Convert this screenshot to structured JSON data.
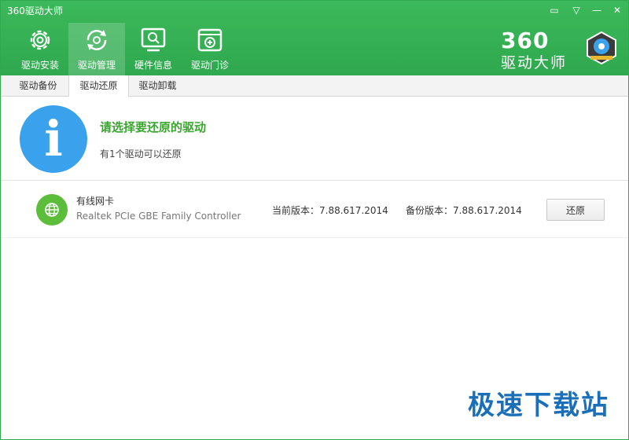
{
  "window": {
    "title": "360驱动大师"
  },
  "window_controls": [
    {
      "icon": "feedback-icon",
      "glyph": "▭"
    },
    {
      "icon": "menu-icon",
      "glyph": "▽"
    },
    {
      "icon": "minimize-icon",
      "glyph": "—"
    },
    {
      "icon": "close-icon",
      "glyph": "✕"
    }
  ],
  "nav": [
    {
      "label": "驱动安装",
      "icon": "gear-icon",
      "active": false
    },
    {
      "label": "驱动管理",
      "icon": "refresh-icon",
      "active": true
    },
    {
      "label": "硬件信息",
      "icon": "monitor-search-icon",
      "active": false
    },
    {
      "label": "驱动门诊",
      "icon": "clinic-icon",
      "active": false
    }
  ],
  "brand": {
    "number": "360",
    "name": "驱动大师"
  },
  "subtabs": [
    {
      "label": "驱动备份",
      "active": false
    },
    {
      "label": "驱动还原",
      "active": true
    },
    {
      "label": "驱动卸载",
      "active": false
    }
  ],
  "info": {
    "icon_glyph": "i",
    "title": "请选择要还原的驱动",
    "subtitle": "有1个驱动可以还原"
  },
  "drivers": [
    {
      "name": "有线网卡",
      "model": "Realtek PCIe GBE Family Controller",
      "current_version": "当前版本：7.88.617.2014",
      "backup_version": "备份版本：7.88.617.2014",
      "action_label": "还原",
      "icon": "network-globe-icon"
    }
  ],
  "watermark": "极速下载站",
  "colors": {
    "header_green": "#2fa84f",
    "title_green": "#3aa52f",
    "info_blue": "#3aa1ec",
    "device_green": "#5cbd3a"
  }
}
